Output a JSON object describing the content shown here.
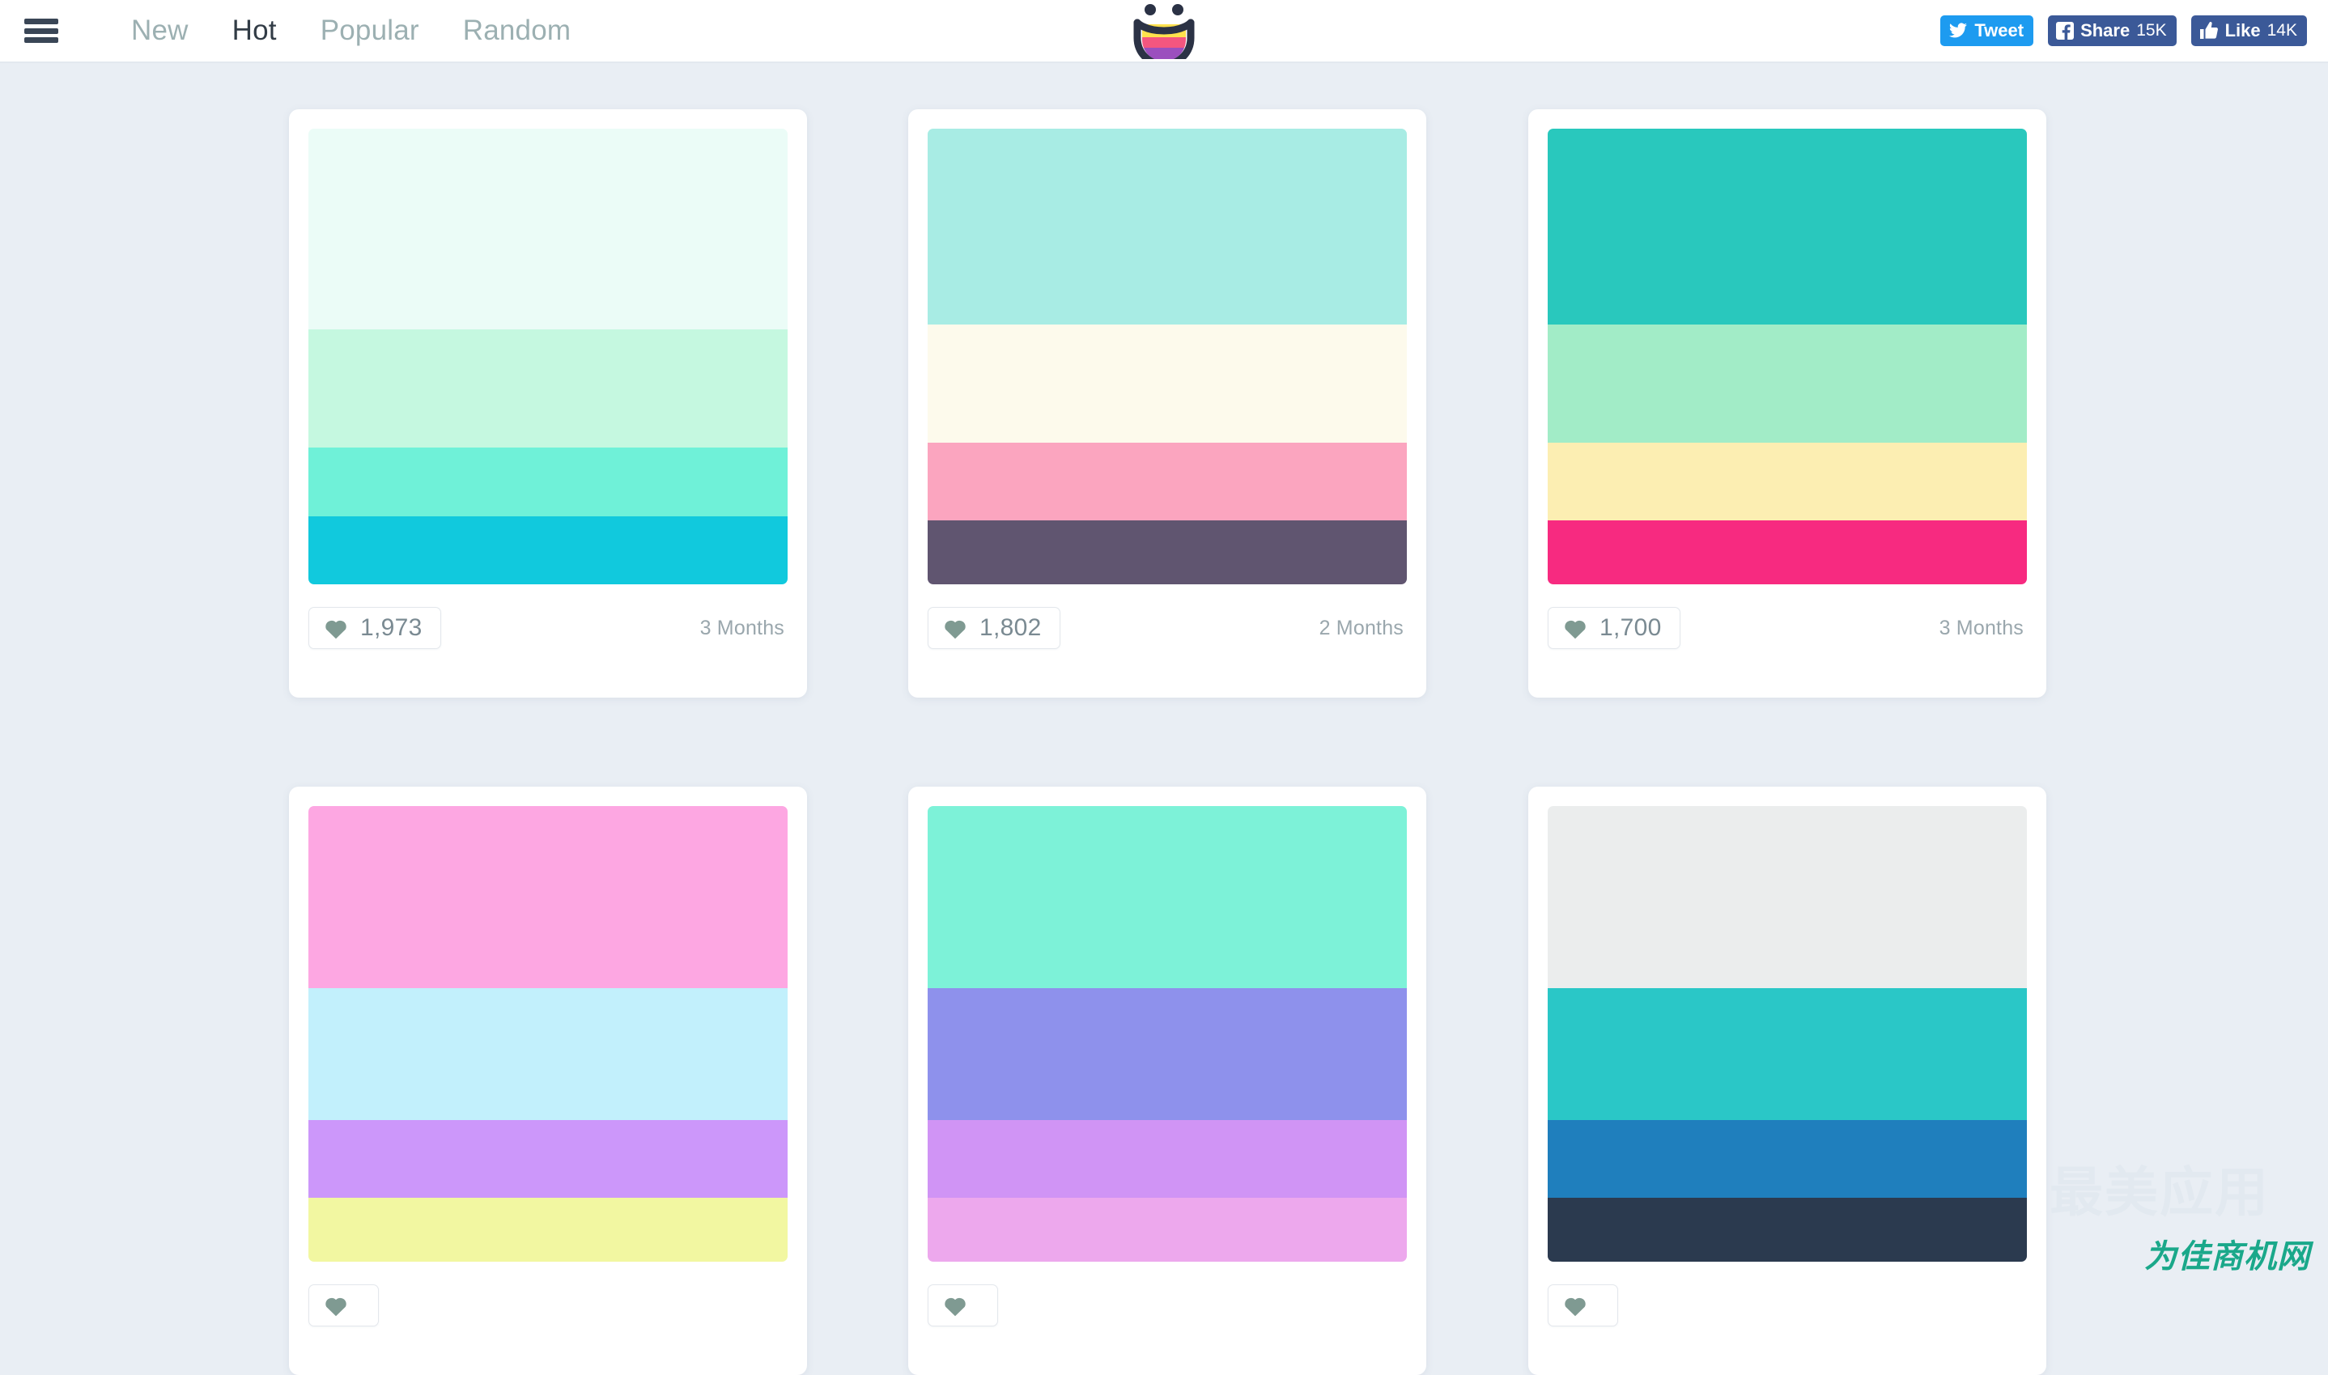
{
  "header": {
    "menu_icon": "hamburger-icon",
    "nav": [
      {
        "label": "New",
        "active": false
      },
      {
        "label": "Hot",
        "active": true
      },
      {
        "label": "Popular",
        "active": false
      },
      {
        "label": "Random",
        "active": false
      }
    ],
    "logo": {
      "name": "colourlovers-smiley-logo",
      "mouth_colors": [
        "#ffe14d",
        "#f4567f",
        "#9b4fbe"
      ],
      "outline_color": "#2b3245"
    },
    "social": [
      {
        "name": "tweet-button",
        "icon": "twitter-icon",
        "label": "Tweet",
        "count": "",
        "color": "#1d9bf0"
      },
      {
        "name": "share-button",
        "icon": "facebook-icon",
        "label": "Share",
        "count": "15K",
        "color": "#3b5998"
      },
      {
        "name": "like-button",
        "icon": "thumbs-up-icon",
        "label": "Like",
        "count": "14K",
        "color": "#3b5998"
      }
    ]
  },
  "theme": {
    "page_background": "#e9eef4",
    "header_background": "#ffffff",
    "card_background": "#ffffff",
    "nav_inactive": "#9cb0b2",
    "nav_active": "#323c46",
    "heart_color": "#7f9a92",
    "meta_text": "#9aa7ad",
    "watermark_color": "#1aa88a"
  },
  "palettes": [
    {
      "id": "palette-1",
      "likes": "1,973",
      "age": "3 Months",
      "colors": [
        "#ebfcf7",
        "#c5f8e0",
        "#6ff1d8",
        "#11c9dd"
      ],
      "heights": [
        44,
        26,
        15,
        15
      ]
    },
    {
      "id": "palette-2",
      "likes": "1,802",
      "age": "2 Months",
      "colors": [
        "#a8ece4",
        "#fdfaec",
        "#fba5bf",
        "#605570"
      ],
      "heights": [
        43,
        26,
        17,
        14
      ]
    },
    {
      "id": "palette-3",
      "likes": "1,700",
      "age": "3 Months",
      "colors": [
        "#29c8bd",
        "#a2ecc7",
        "#fceeb2",
        "#f72a80"
      ],
      "heights": [
        43,
        26,
        17,
        14
      ]
    },
    {
      "id": "palette-4",
      "likes": "",
      "age": "",
      "colors": [
        "#fda7e2",
        "#c2f0fc",
        "#cc97fa",
        "#f2f7a1"
      ],
      "heights": [
        40,
        29,
        17,
        14
      ]
    },
    {
      "id": "palette-5",
      "likes": "",
      "age": "",
      "colors": [
        "#7df2d8",
        "#8e91ec",
        "#d094f5",
        "#eda8ed"
      ],
      "heights": [
        40,
        29,
        17,
        14
      ]
    },
    {
      "id": "palette-6",
      "likes": "",
      "age": "",
      "colors": [
        "#ebeded",
        "#2ac7c7",
        "#1f7fbd",
        "#2b3a4f"
      ],
      "heights": [
        40,
        29,
        17,
        14
      ]
    }
  ],
  "watermark": {
    "faint_text": "最美应用",
    "main_text": "为佳商机网"
  }
}
